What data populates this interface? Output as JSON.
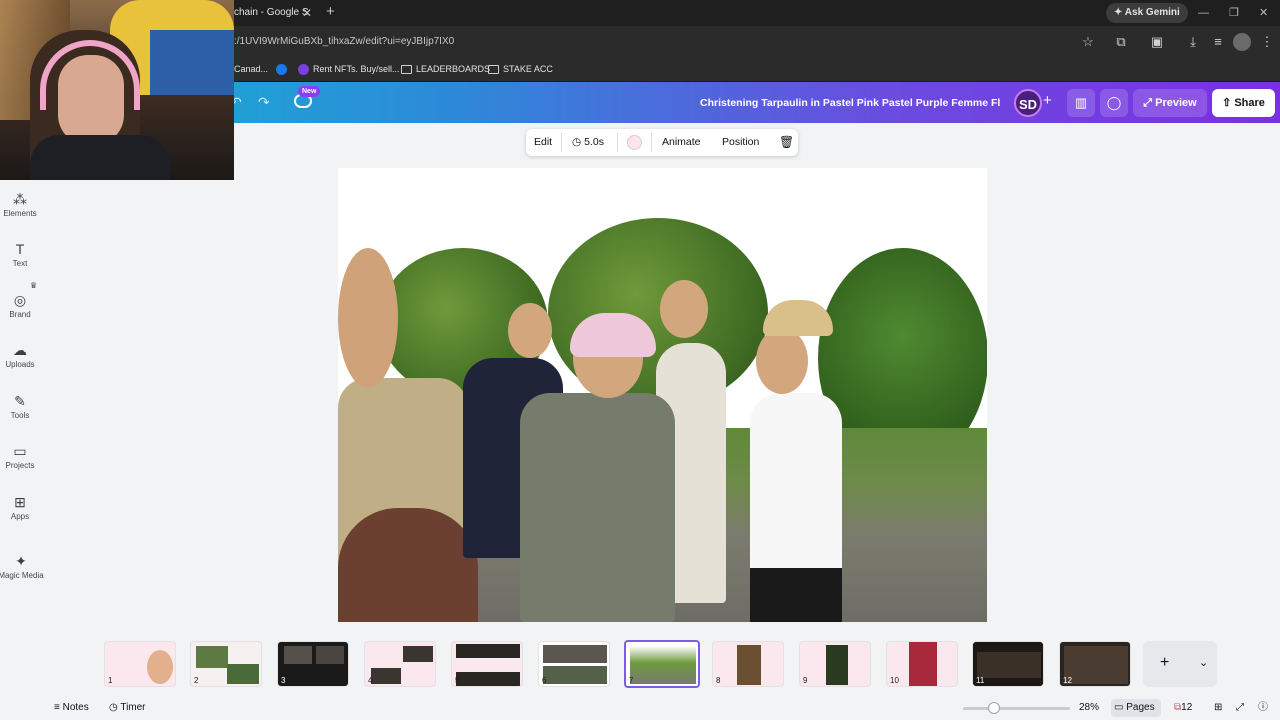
{
  "browser": {
    "tab_title": "chain - Google S",
    "tab_close": "✕",
    "new_tab": "+",
    "ask_gemini": "Ask Gemini",
    "url": ":/1UVI9WrMiGuBXb_tihxaZw/edit?ui=eyJBIjp7IX0",
    "bookmarks": [
      "Canad...",
      "Rent NFTs. Buy/sell...",
      "LEADERBOARDS",
      "STAKE ACC"
    ],
    "win_controls": [
      "—",
      "❐",
      "✕"
    ]
  },
  "header": {
    "new_badge": "New",
    "doc_title": "Christening Tarpaulin in Pastel Pink Pastel Purple Femme Fl...",
    "avatar_initials": "SD",
    "add": "+",
    "preview_label": "Preview",
    "share_label": "Share"
  },
  "sidebar": {
    "items": [
      {
        "label": "Elements",
        "icon": "elements-icon",
        "glyph": "⁂"
      },
      {
        "label": "Text",
        "icon": "text-icon",
        "glyph": "T"
      },
      {
        "label": "Brand",
        "icon": "brand-icon",
        "glyph": "◎"
      },
      {
        "label": "Uploads",
        "icon": "upload-icon",
        "glyph": "☁"
      },
      {
        "label": "Tools",
        "icon": "tools-icon",
        "glyph": "✎"
      },
      {
        "label": "Projects",
        "icon": "folder-icon",
        "glyph": "▭"
      },
      {
        "label": "Apps",
        "icon": "apps-icon",
        "glyph": "⊞"
      },
      {
        "label": "Magic Media",
        "icon": "magic-media-icon",
        "glyph": "✦"
      }
    ]
  },
  "context_toolbar": {
    "edit": "Edit",
    "duration": "5.0s",
    "animate": "Animate",
    "position": "Position"
  },
  "pages": {
    "numbers": [
      "1",
      "2",
      "3",
      "4",
      "5",
      "6",
      "7",
      "8",
      "9",
      "10",
      "11",
      "12"
    ],
    "selected": "7"
  },
  "footer": {
    "notes": "Notes",
    "timer": "Timer",
    "zoom": "28%",
    "pages_label": "Pages",
    "page_count": "12"
  },
  "colors": {
    "accent": "#8b3dff",
    "header_start": "#12b7d4",
    "header_end": "#7b2fe3",
    "selected_thumb_border": "#7d5ce4"
  }
}
